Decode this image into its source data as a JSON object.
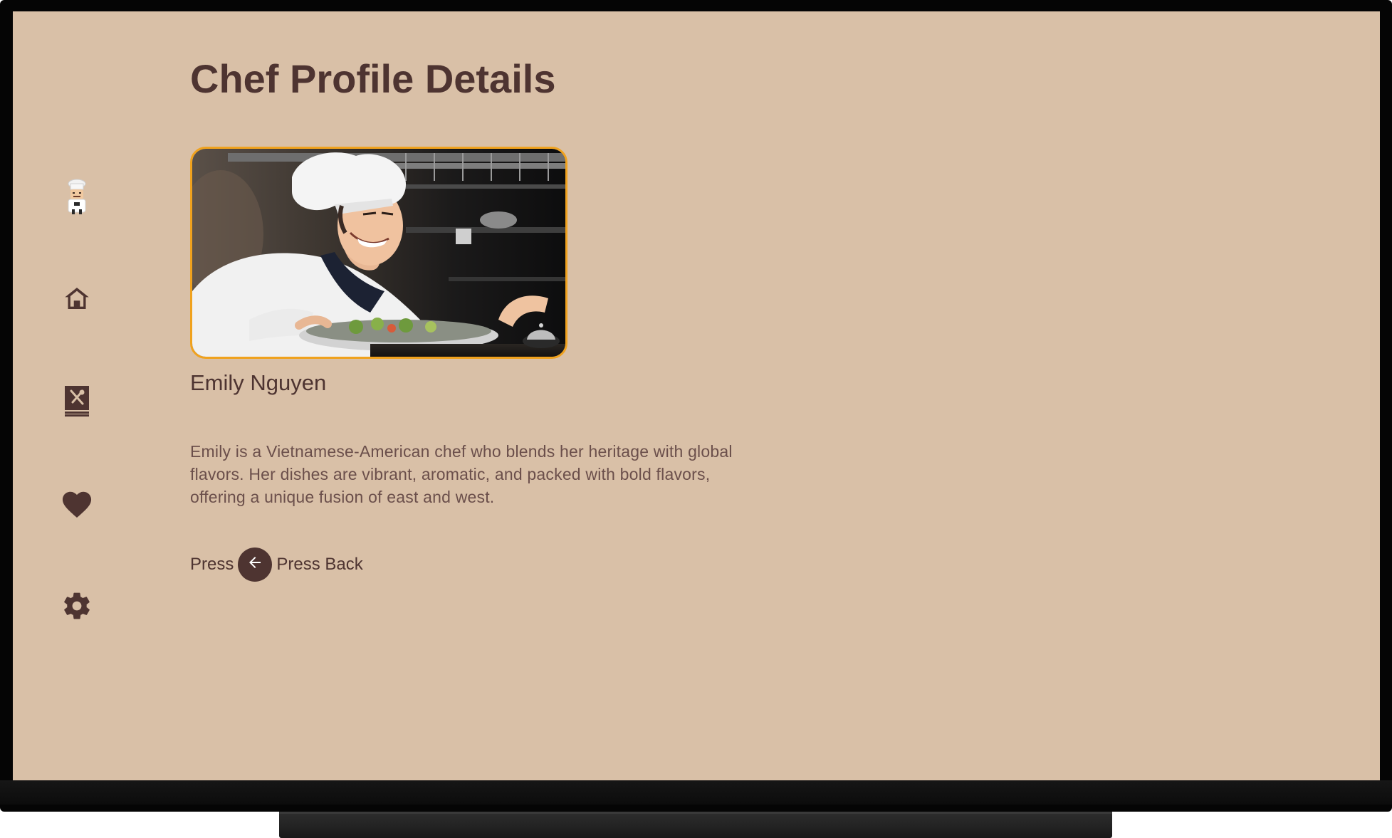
{
  "page": {
    "title": "Chef Profile Details"
  },
  "nav": {
    "items": [
      {
        "icon": "chef-avatar-icon"
      },
      {
        "icon": "home-icon"
      },
      {
        "icon": "recipe-book-icon"
      },
      {
        "icon": "favorite-heart-icon"
      },
      {
        "icon": "settings-gear-icon"
      }
    ]
  },
  "chef": {
    "name": "Emily Nguyen",
    "bio": "Emily is a Vietnamese-American chef who blends her heritage with global flavors. Her dishes are vibrant, aromatic, and packed with bold flavors, offering a unique fusion of east and west."
  },
  "back_hint": {
    "prefix": "Press",
    "label": "Press Back"
  },
  "colors": {
    "background": "#d9c0a7",
    "text_primary": "#4e3431",
    "text_secondary": "#6b4f4b",
    "accent_border": "#f0a21e"
  }
}
